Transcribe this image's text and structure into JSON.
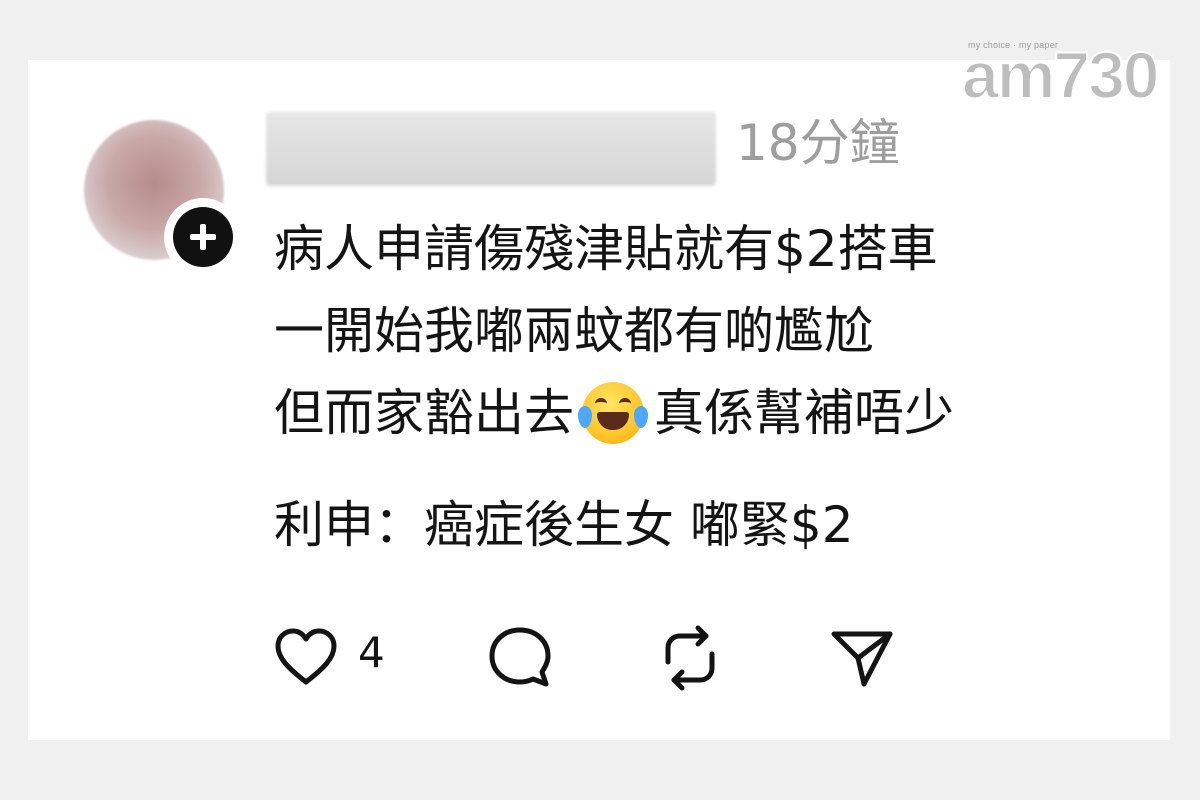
{
  "watermark": {
    "tagline": "my choice · my paper",
    "brand": "am730"
  },
  "post": {
    "timestamp": "18分鐘",
    "lines": [
      "病人申請傷殘津貼就有$2搭車",
      "一開始我嘟兩蚊都有啲尷尬",
      "但而家豁出去",
      "真係幫補唔少",
      "利申：癌症後生女 嘟緊$2"
    ],
    "emoji": "laughing-with-tears-emoji"
  },
  "actions": {
    "like_count": "4",
    "icons": [
      "heart-icon",
      "comment-icon",
      "repost-icon",
      "share-icon"
    ]
  }
}
